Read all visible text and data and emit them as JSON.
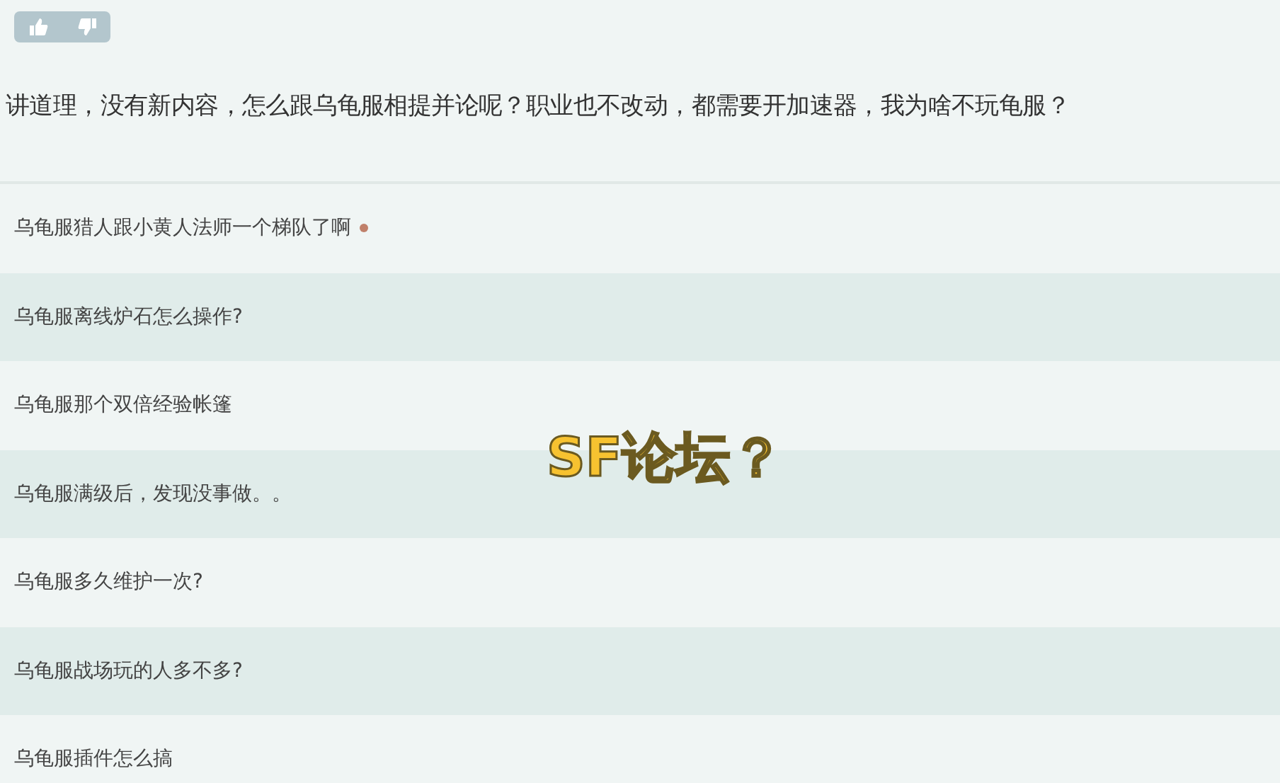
{
  "question": "讲道理，没有新内容，怎么跟乌龟服相提并论呢？职业也不改动，都需要开加速器，我为啥不玩龟服？",
  "topics": [
    {
      "title": "乌龟服猎人跟小黄人法师一个梯队了啊",
      "new": true
    },
    {
      "title": "乌龟服离线炉石怎么操作?",
      "new": false
    },
    {
      "title": "乌龟服那个双倍经验帐篷",
      "new": false
    },
    {
      "title": "乌龟服满级后，发现没事做。。",
      "new": false
    },
    {
      "title": "乌龟服多久维护一次?",
      "new": false
    },
    {
      "title": "乌龟服战场玩的人多不多?",
      "new": false
    },
    {
      "title": "乌龟服插件怎么搞",
      "new": false
    }
  ],
  "caption": "SF论坛？"
}
